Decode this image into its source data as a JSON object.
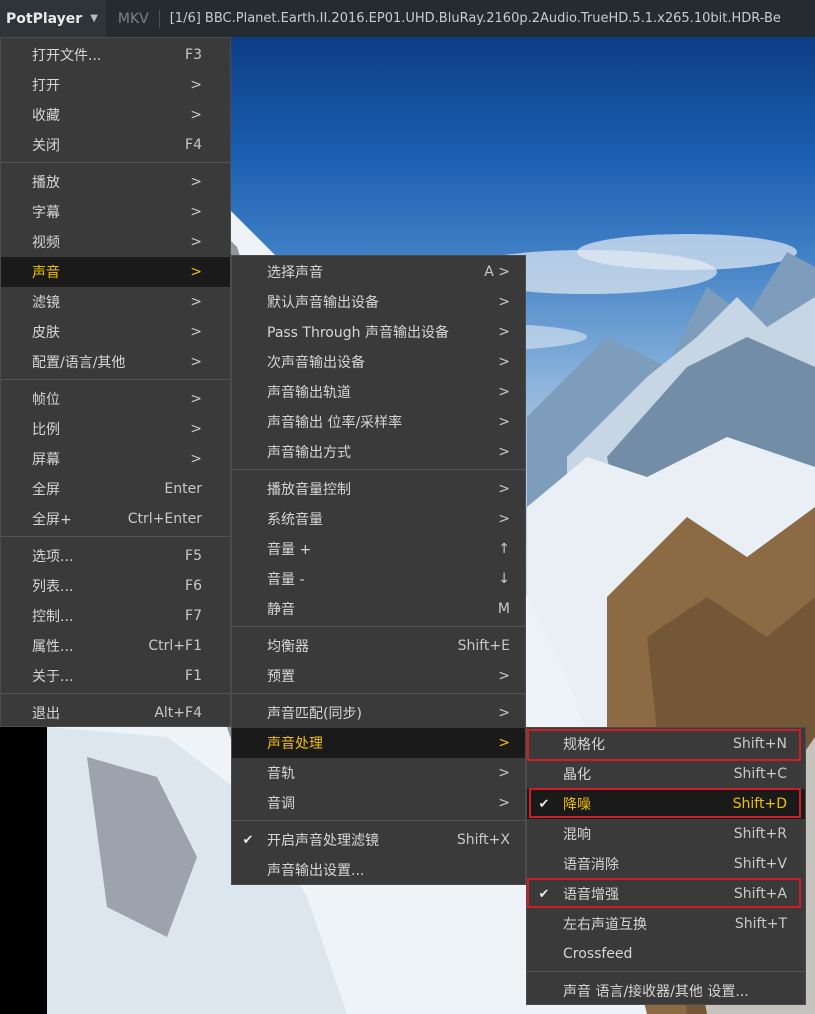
{
  "titlebar": {
    "app": "PotPlayer",
    "format": "MKV",
    "title": "[1/6] BBC.Planet.Earth.II.2016.EP01.UHD.BluRay.2160p.2Audio.TrueHD.5.1.x265.10bit.HDR-Be"
  },
  "main_menu": {
    "items": [
      {
        "label": "打开文件...",
        "shortcut": "F3"
      },
      {
        "label": "打开",
        "shortcut": ">"
      },
      {
        "label": "收藏",
        "shortcut": ">"
      },
      {
        "label": "关闭",
        "shortcut": "F4"
      },
      {
        "label": "播放",
        "shortcut": ">"
      },
      {
        "label": "字幕",
        "shortcut": ">"
      },
      {
        "label": "视频",
        "shortcut": ">"
      },
      {
        "label": "声音",
        "shortcut": ">"
      },
      {
        "label": "滤镜",
        "shortcut": ">"
      },
      {
        "label": "皮肤",
        "shortcut": ">"
      },
      {
        "label": "配置/语言/其他",
        "shortcut": ">"
      },
      {
        "label": "帧位",
        "shortcut": ">"
      },
      {
        "label": "比例",
        "shortcut": ">"
      },
      {
        "label": "屏幕",
        "shortcut": ">"
      },
      {
        "label": "全屏",
        "shortcut": "Enter"
      },
      {
        "label": "全屏+",
        "shortcut": "Ctrl+Enter"
      },
      {
        "label": "选项...",
        "shortcut": "F5"
      },
      {
        "label": "列表...",
        "shortcut": "F6"
      },
      {
        "label": "控制...",
        "shortcut": "F7"
      },
      {
        "label": "属性...",
        "shortcut": "Ctrl+F1"
      },
      {
        "label": "关于...",
        "shortcut": "F1"
      },
      {
        "label": "退出",
        "shortcut": "Alt+F4"
      }
    ]
  },
  "audio_menu": {
    "items": [
      {
        "label": "选择声音",
        "shortcut": "A >"
      },
      {
        "label": "默认声音输出设备",
        "shortcut": ">"
      },
      {
        "label": "Pass Through 声音输出设备",
        "shortcut": ">"
      },
      {
        "label": "次声音输出设备",
        "shortcut": ">"
      },
      {
        "label": "声音输出轨道",
        "shortcut": ">"
      },
      {
        "label": "声音输出 位率/采样率",
        "shortcut": ">"
      },
      {
        "label": "声音输出方式",
        "shortcut": ">"
      },
      {
        "label": "播放音量控制",
        "shortcut": ">"
      },
      {
        "label": "系统音量",
        "shortcut": ">"
      },
      {
        "label": "音量 +",
        "shortcut": "↑"
      },
      {
        "label": "音量 -",
        "shortcut": "↓"
      },
      {
        "label": "静音",
        "shortcut": "M"
      },
      {
        "label": "均衡器",
        "shortcut": "Shift+E"
      },
      {
        "label": "预置",
        "shortcut": ">"
      },
      {
        "label": "声音匹配(同步)",
        "shortcut": ">"
      },
      {
        "label": "声音处理",
        "shortcut": ">"
      },
      {
        "label": "音轨",
        "shortcut": ">"
      },
      {
        "label": "音调",
        "shortcut": ">"
      },
      {
        "label": "开启声音处理滤镜",
        "shortcut": "Shift+X",
        "checked": true
      },
      {
        "label": "声音输出设置...",
        "shortcut": ""
      }
    ]
  },
  "processing_menu": {
    "items": [
      {
        "label": "规格化",
        "shortcut": "Shift+N",
        "checked": false
      },
      {
        "label": "晶化",
        "shortcut": "Shift+C",
        "checked": false
      },
      {
        "label": "降噪",
        "shortcut": "Shift+D",
        "checked": true
      },
      {
        "label": "混响",
        "shortcut": "Shift+R",
        "checked": false
      },
      {
        "label": "语音消除",
        "shortcut": "Shift+V",
        "checked": false
      },
      {
        "label": "语音增强",
        "shortcut": "Shift+A",
        "checked": true
      },
      {
        "label": "左右声道互换",
        "shortcut": "Shift+T",
        "checked": false
      },
      {
        "label": "Crossfeed",
        "shortcut": "",
        "checked": false
      },
      {
        "label": "声音 语言/接收器/其他 设置...",
        "shortcut": "",
        "checked": false
      }
    ]
  },
  "icons": {
    "check": "checkmark-icon",
    "dropdown": "chevron-down-icon"
  },
  "colors": {
    "highlight_text": "#f0c000",
    "menu_bg": "#3a3a3a",
    "annotation_box": "#d01c26"
  }
}
